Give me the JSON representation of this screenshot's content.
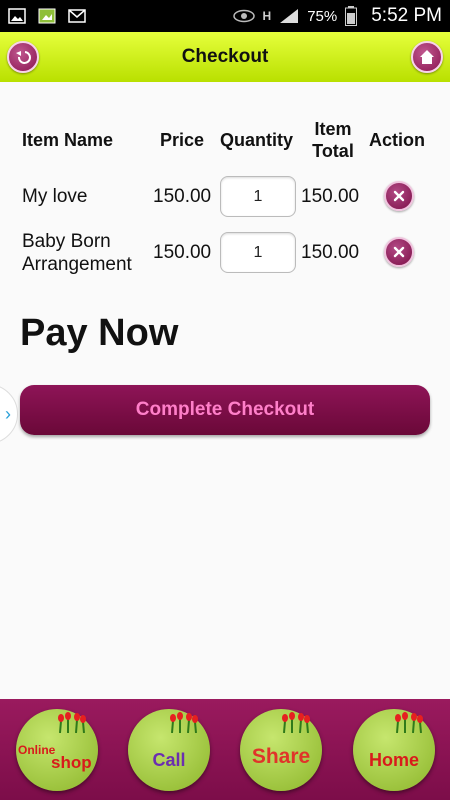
{
  "status_bar": {
    "battery": "75%",
    "time": "5:52 PM",
    "network": "H"
  },
  "title_bar": {
    "title": "Checkout"
  },
  "table": {
    "headers": {
      "item_name": "Item Name",
      "price": "Price",
      "quantity": "Quantity",
      "item_total_line1": "Item",
      "item_total_line2": "Total",
      "action": "Action"
    },
    "rows": [
      {
        "name_line1": "My love",
        "name_line2": "",
        "price": "150.00",
        "quantity": "1",
        "total": "150.00"
      },
      {
        "name_line1": "Baby Born",
        "name_line2": "Arrangement",
        "price": "150.00",
        "quantity": "1",
        "total": "150.00"
      }
    ]
  },
  "pay_now": "Pay Now",
  "checkout_button": "Complete Checkout",
  "bottom_nav": [
    {
      "label_line1": "Online",
      "label_line2": "shop",
      "color": "#d81b1b"
    },
    {
      "label_line1": "Call",
      "label_line2": "",
      "color": "#6b2fb0"
    },
    {
      "label_line1": "Share",
      "label_line2": "",
      "color": "#e0342a"
    },
    {
      "label_line1": "Home",
      "label_line2": "",
      "color": "#d81b1b"
    }
  ],
  "colors": {
    "accent_lime": "#c8f000",
    "accent_magenta": "#8a1450",
    "checkout_text": "#ff7fc9"
  }
}
